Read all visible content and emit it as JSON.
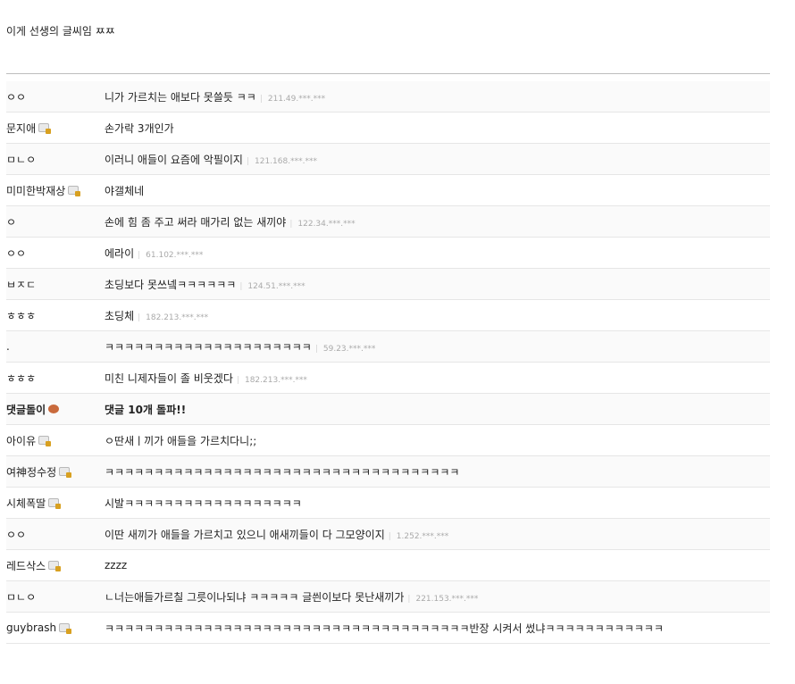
{
  "headline": "이게 선생의 글씨임 ㅉㅉ",
  "comments": [
    {
      "nick": "ㅇㅇ",
      "text": "니가 가르치는 애보다 못쓸듯 ㅋㅋ",
      "ip": "211.49.***.***",
      "badge": false,
      "bold": false
    },
    {
      "nick": "문지애",
      "text": "손가락 3개인가",
      "ip": "",
      "badge": true,
      "bold": false
    },
    {
      "nick": "ㅁㄴㅇ",
      "text": "이러니 애들이 요즘에 악필이지",
      "ip": "121.168.***.***",
      "badge": false,
      "bold": false
    },
    {
      "nick": "미미한박재상",
      "text": "야갤체네",
      "ip": "",
      "badge": true,
      "bold": false
    },
    {
      "nick": "ㅇ",
      "text": "손에 힘 좀 주고 써라 매가리 없는 새끼야",
      "ip": "122.34.***.***",
      "badge": false,
      "bold": false
    },
    {
      "nick": "ㅇㅇ",
      "text": "에라이",
      "ip": "61.102.***.***",
      "badge": false,
      "bold": false
    },
    {
      "nick": "ㅂㅈㄷ",
      "text": "초딩보다 못쓰넼ㅋㅋㅋㅋㅋㅋ",
      "ip": "124.51.***.***",
      "badge": false,
      "bold": false
    },
    {
      "nick": "ㅎㅎㅎ",
      "text": "초딩체",
      "ip": "182.213.***.***",
      "badge": false,
      "bold": false
    },
    {
      "nick": ".",
      "text": "ㅋㅋㅋㅋㅋㅋㅋㅋㅋㅋㅋㅋㅋㅋㅋㅋㅋㅋㅋㅋㅋ",
      "ip": "59.23.***.***",
      "badge": false,
      "bold": false
    },
    {
      "nick": "ㅎㅎㅎ",
      "text": "미친 니제자들이 졸 비웃겠다",
      "ip": "182.213.***.***",
      "badge": false,
      "bold": false
    },
    {
      "nick": "댓글돌이",
      "text": "댓글 10개 돌파!!",
      "ip": "",
      "badge": "mascot",
      "bold": true
    },
    {
      "nick": "아이유",
      "text": "ㅇ딴새ㅣ끼가 애들을 가르치다니;;",
      "ip": "",
      "badge": true,
      "bold": false
    },
    {
      "nick": "여神정수정",
      "text": "ㅋㅋㅋㅋㅋㅋㅋㅋㅋㅋㅋㅋㅋㅋㅋㅋㅋㅋㅋㅋㅋㅋㅋㅋㅋㅋㅋㅋㅋㅋㅋㅋㅋㅋㅋㅋ",
      "ip": "",
      "badge": true,
      "bold": false
    },
    {
      "nick": "시체폭딸",
      "text": "시발ㅋㅋㅋㅋㅋㅋㅋㅋㅋㅋㅋㅋㅋㅋㅋㅋㅋㅋ",
      "ip": "",
      "badge": true,
      "bold": false
    },
    {
      "nick": "ㅇㅇ",
      "text": "이딴 새끼가 애들을 가르치고 있으니 애새끼들이 다 그모양이지",
      "ip": "1.252.***.***",
      "badge": false,
      "bold": false
    },
    {
      "nick": "레드삭스",
      "text": "zzzz",
      "ip": "",
      "badge": true,
      "bold": false
    },
    {
      "nick": "ㅁㄴㅇ",
      "text": "ㄴ너는애들가르칠 그릇이나되냐 ㅋㅋㅋㅋㅋ 글씐이보다 못난새끼가",
      "ip": "221.153.***.***",
      "badge": false,
      "bold": false
    },
    {
      "nick": "guybrash",
      "text": "ㅋㅋㅋㅋㅋㅋㅋㅋㅋㅋㅋㅋㅋㅋㅋㅋㅋㅋㅋㅋㅋㅋㅋㅋㅋㅋㅋㅋㅋㅋㅋㅋㅋㅋㅋㅋㅋ반장 시켜서 썼냐ㅋㅋㅋㅋㅋㅋㅋㅋㅋㅋㅋㅋ",
      "ip": "",
      "badge": true,
      "bold": false
    }
  ]
}
